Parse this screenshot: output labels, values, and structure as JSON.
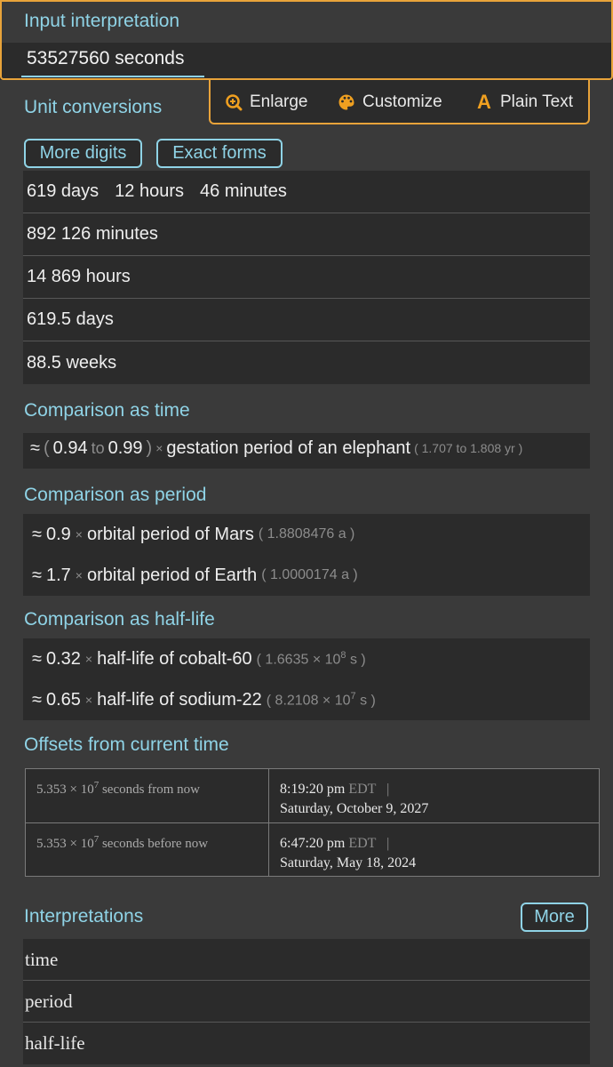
{
  "input_interpretation": {
    "title": "Input interpretation",
    "value": "53527560 seconds"
  },
  "toolbar": {
    "enlarge": "Enlarge",
    "customize": "Customize",
    "plain_text": "Plain Text",
    "plain_text_icon": "A"
  },
  "unit_conversions": {
    "title": "Unit conversions",
    "more_digits": "More digits",
    "exact_forms": "Exact forms",
    "rows": [
      [
        "619 days",
        "12 hours",
        "46 minutes"
      ],
      "892 126 minutes",
      "14 869 hours",
      "619.5 days",
      "88.5 weeks"
    ]
  },
  "comparison_time": {
    "title": "Comparison as time",
    "approx": "≈",
    "open": "(",
    "low": "0.94",
    "to": "to",
    "high": "0.99",
    "close": ")",
    "times": "×",
    "label": "gestation period of an elephant",
    "range": "( 1.707  to  1.808 yr )"
  },
  "comparison_period": {
    "title": "Comparison as period",
    "rows": [
      {
        "approx": "≈",
        "factor": "0.9",
        "times": "×",
        "label": "orbital period of Mars",
        "detail": "( 1.8808476 a )"
      },
      {
        "approx": "≈",
        "factor": "1.7",
        "times": "×",
        "label": "orbital period of Earth",
        "detail": "( 1.0000174 a )"
      }
    ]
  },
  "comparison_halflife": {
    "title": "Comparison as half-life",
    "rows": [
      {
        "approx": "≈",
        "factor": "0.32",
        "times": "×",
        "label": "half-life of cobalt-60",
        "detail_open": "( 1.6635 × 10",
        "detail_exp": "8",
        "detail_close": " s )"
      },
      {
        "approx": "≈",
        "factor": "0.65",
        "times": "×",
        "label": "half-life of sodium-22",
        "detail_open": "( 8.2108 × 10",
        "detail_exp": "7",
        "detail_close": " s )"
      }
    ]
  },
  "offsets": {
    "title": "Offsets from current time",
    "rows": [
      {
        "mantissa": "5.353 × 10",
        "exp": "7",
        "suffix": " seconds from now",
        "time": "8:19:20 pm",
        "tz": "EDT",
        "sep": "|",
        "date": "Saturday, October 9, 2027"
      },
      {
        "mantissa": "5.353 × 10",
        "exp": "7",
        "suffix": " seconds before now",
        "time": "6:47:20 pm",
        "tz": "EDT",
        "sep": "|",
        "date": "Saturday, May 18, 2024"
      }
    ]
  },
  "interpretations": {
    "title": "Interpretations",
    "more": "More",
    "items": [
      "time",
      "period",
      "half-life"
    ]
  },
  "colors": {
    "accent": "#8fd3e6",
    "highlight": "#e8a33a",
    "icon": "#f0a020"
  }
}
